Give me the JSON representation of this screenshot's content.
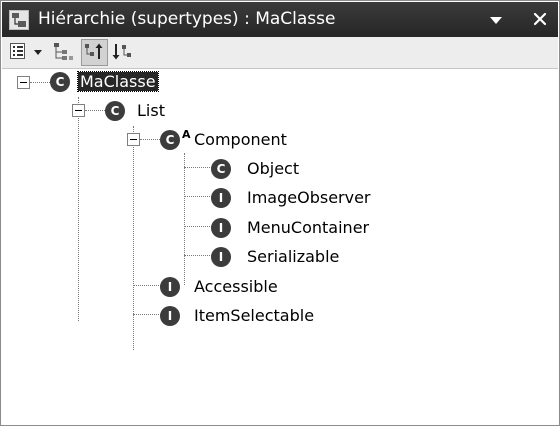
{
  "window": {
    "title": "Hiérarchie (supertypes) : MaClasse",
    "view_icon": "hierarchy-icon",
    "menu_icon": "view-menu-icon",
    "close_icon": "close-icon",
    "close_label": "×"
  },
  "toolbar": {
    "buttons": [
      {
        "name": "layout-menu-button",
        "icon": "list-layout-icon"
      },
      {
        "name": "type-hierarchy-button",
        "icon": "type-hierarchy-icon"
      },
      {
        "name": "supertype-hierarchy-button",
        "icon": "supertype-hierarchy-icon",
        "pressed": true
      },
      {
        "name": "subtype-hierarchy-button",
        "icon": "subtype-hierarchy-icon"
      }
    ]
  },
  "tree": {
    "nodes": [
      {
        "label": "MaClasse",
        "kind": "C",
        "depth": 0,
        "expanded": true,
        "selected": true
      },
      {
        "label": "List",
        "kind": "C",
        "depth": 1,
        "expanded": true
      },
      {
        "label": "Component",
        "kind": "C",
        "superscript": "A",
        "depth": 2,
        "expanded": true
      },
      {
        "label": "Object",
        "kind": "C",
        "depth": 3
      },
      {
        "label": "ImageObserver",
        "kind": "I",
        "depth": 3
      },
      {
        "label": "MenuContainer",
        "kind": "I",
        "depth": 3
      },
      {
        "label": "Serializable",
        "kind": "I",
        "depth": 3
      },
      {
        "label": "Accessible",
        "kind": "I",
        "depth": 2
      },
      {
        "label": "ItemSelectable",
        "kind": "I",
        "depth": 2
      }
    ]
  },
  "colors": {
    "title_bar": "#2f2f2f",
    "badge": "#3c3c3c",
    "selection": "#262626"
  }
}
